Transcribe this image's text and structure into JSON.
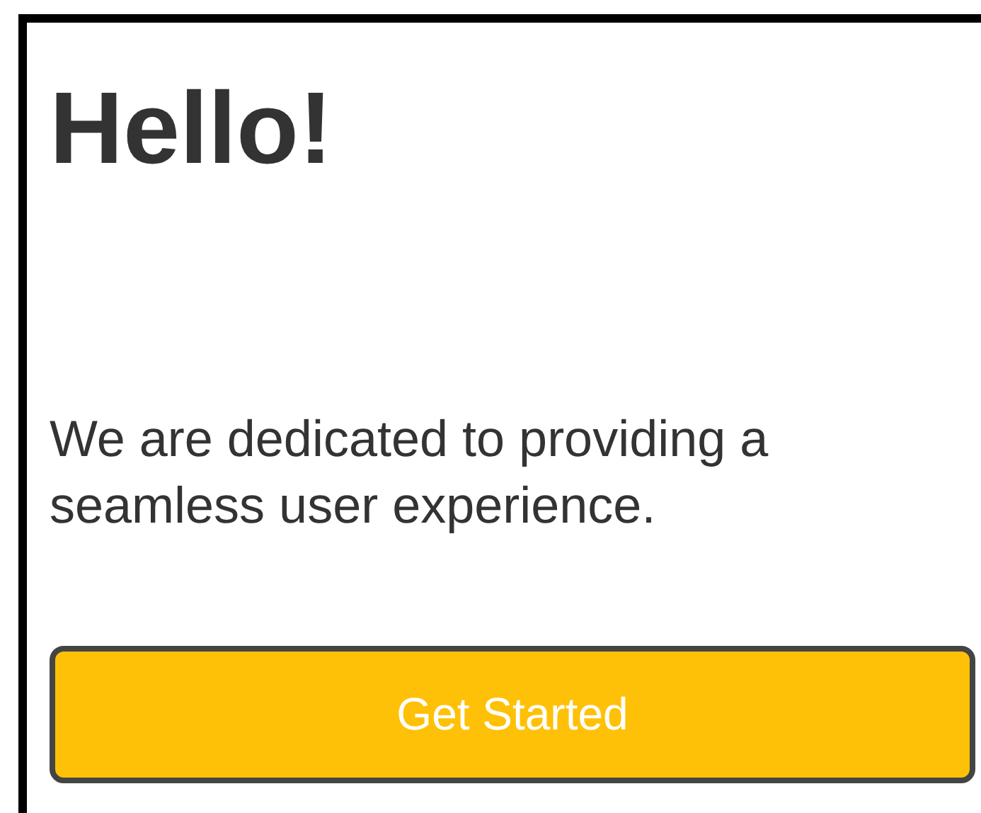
{
  "heading": "Hello!",
  "message": "We are dedicated to providing a seamless user experience.",
  "button": {
    "label": "Get Started"
  }
}
